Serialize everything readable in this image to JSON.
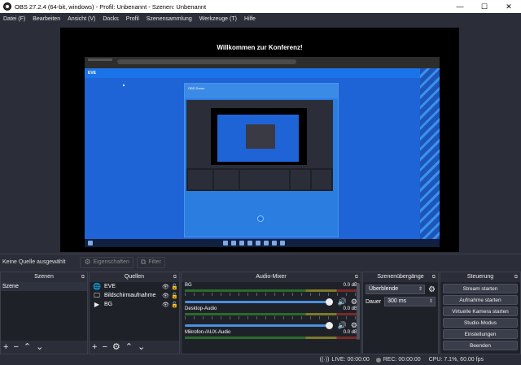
{
  "window": {
    "title": "OBS 27.2.4 (64-bit, windows) - Profil: Unbenannt - Szenen: Unbenannt",
    "minimize": "—",
    "maximize": "☐",
    "close": "✕"
  },
  "menu": [
    "Datei (F)",
    "Bearbeiten",
    "Ansicht (V)",
    "Docks",
    "Profil",
    "Szenensammlung",
    "Werkzeuge (T)",
    "Hilfe"
  ],
  "preview": {
    "banner": "Willkommen zur Konferenz!",
    "eve_label": "EVE",
    "inner_title": "OBS Demo"
  },
  "source_toolbar": {
    "no_selection": "Keine Quelle ausgewählt",
    "properties": "Eigenschaften",
    "filters": "Filter"
  },
  "scenes": {
    "title": "Szenen",
    "items": [
      "Szene"
    ]
  },
  "sources": {
    "title": "Quellen",
    "items": [
      {
        "label": "EVE",
        "icon": "globe-icon"
      },
      {
        "label": "Bildschirmaufnahme",
        "icon": "monitor-icon"
      },
      {
        "label": "BG",
        "icon": "play-icon"
      }
    ]
  },
  "mixer": {
    "title": "Audio-Mixer",
    "channels": [
      {
        "name": "BG",
        "db": "0.0 dB"
      },
      {
        "name": "Desktop-Audio",
        "db": "0.0 dB"
      },
      {
        "name": "Mikrofon-/AUX-Audio",
        "db": "0.0 dB"
      }
    ]
  },
  "transitions": {
    "title": "Szenenübergänge",
    "selected": "Überblende",
    "duration_label": "Dauer",
    "duration_value": "300 ms"
  },
  "controls": {
    "title": "Steuerung",
    "buttons": [
      "Stream starten",
      "Aufnahme starten",
      "Virtuelle Kamera starten",
      "Studio-Modus",
      "Einstellungen",
      "Beenden"
    ]
  },
  "status": {
    "live": "LIVE: 00:00:00",
    "rec": "REC: 00:00:00",
    "cpu": "CPU: 7.1%, 60.00 fps"
  }
}
